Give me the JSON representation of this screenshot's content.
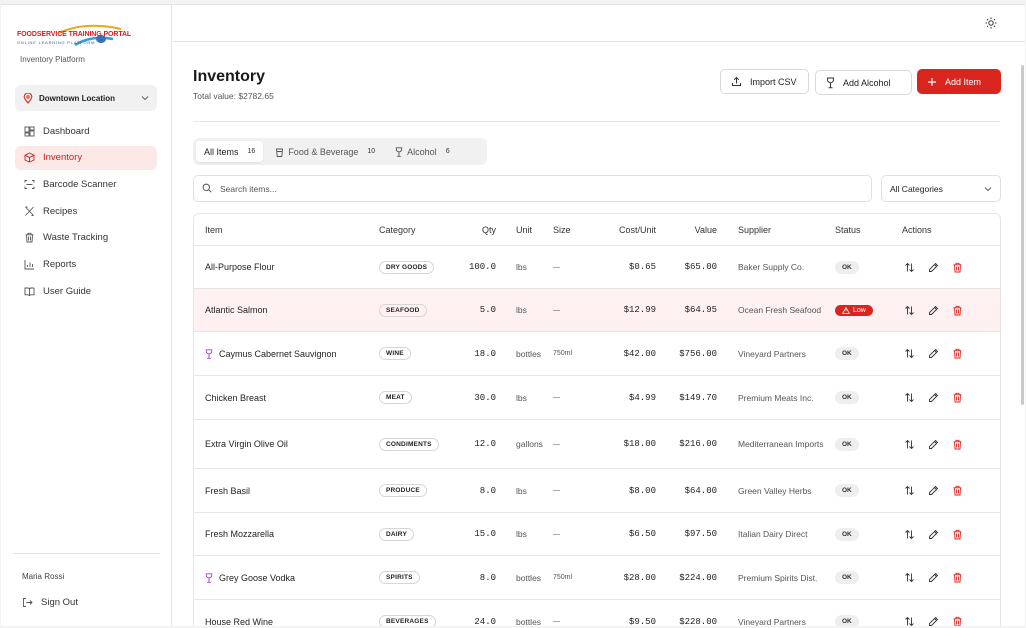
{
  "brand": {
    "logo_text": "FOODSERVICE TRAINING PORTAL",
    "logo_subtext": "ONLINE LEARNING PLATFORM",
    "platform_label": "Inventory Platform"
  },
  "location": {
    "label": "Downtown Location"
  },
  "sidebar": {
    "items": [
      {
        "label": "Dashboard",
        "icon": "dashboard-icon",
        "active": false
      },
      {
        "label": "Inventory",
        "icon": "package-icon",
        "active": true
      },
      {
        "label": "Barcode Scanner",
        "icon": "scan-icon",
        "active": false
      },
      {
        "label": "Recipes",
        "icon": "utensils-icon",
        "active": false
      },
      {
        "label": "Waste Tracking",
        "icon": "trash-icon",
        "active": false
      },
      {
        "label": "Reports",
        "icon": "bar-chart-icon",
        "active": false
      },
      {
        "label": "User Guide",
        "icon": "book-icon",
        "active": false
      }
    ],
    "user_name": "Maria Rossi",
    "signout_label": "Sign Out"
  },
  "header": {
    "title": "Inventory",
    "total_value": "Total value: $2782.65",
    "import_label": "Import CSV",
    "add_alcohol_label": "Add Alcohol",
    "add_item_label": "Add Item"
  },
  "tabs": [
    {
      "label": "All Items",
      "count": "16",
      "active": true
    },
    {
      "label": "Food & Beverage",
      "count": "10",
      "active": false
    },
    {
      "label": "Alcohol",
      "count": "6",
      "active": false
    }
  ],
  "search": {
    "placeholder": "Search items..."
  },
  "category_filter": {
    "selected": "All Categories"
  },
  "table": {
    "headers": {
      "item": "Item",
      "category": "Category",
      "qty": "Qty",
      "unit": "Unit",
      "size": "Size",
      "cost": "Cost/Unit",
      "value": "Value",
      "supplier": "Supplier",
      "status": "Status",
      "actions": "Actions"
    },
    "rows": [
      {
        "item": "All-Purpose Flour",
        "alcohol": false,
        "category": "DRY GOODS",
        "qty": "100.0",
        "unit": "lbs",
        "size": "—",
        "cost": "$0.65",
        "value": "$65.00",
        "supplier": "Baker Supply Co.",
        "status": "OK",
        "low": false
      },
      {
        "item": "Atlantic Salmon",
        "alcohol": false,
        "category": "SEAFOOD",
        "qty": "5.0",
        "unit": "lbs",
        "size": "—",
        "cost": "$12.99",
        "value": "$64.95",
        "supplier": "Ocean Fresh Seafood",
        "status": "Low",
        "low": true
      },
      {
        "item": "Caymus Cabernet Sauvignon",
        "alcohol": true,
        "category": "WINE",
        "qty": "18.0",
        "unit": "bottles",
        "size": "750ml",
        "cost": "$42.00",
        "value": "$756.00",
        "supplier": "Vineyard Partners",
        "status": "OK",
        "low": false
      },
      {
        "item": "Chicken Breast",
        "alcohol": false,
        "category": "MEAT",
        "qty": "30.0",
        "unit": "lbs",
        "size": "—",
        "cost": "$4.99",
        "value": "$149.70",
        "supplier": "Premium Meats Inc.",
        "status": "OK",
        "low": false
      },
      {
        "item": "Extra Virgin Olive Oil",
        "alcohol": false,
        "category": "CONDIMENTS",
        "qty": "12.0",
        "unit": "gallons",
        "size": "—",
        "cost": "$18.00",
        "value": "$216.00",
        "supplier": "Mediterranean Imports",
        "status": "OK",
        "low": false
      },
      {
        "item": "Fresh Basil",
        "alcohol": false,
        "category": "PRODUCE",
        "qty": "8.0",
        "unit": "lbs",
        "size": "—",
        "cost": "$8.00",
        "value": "$64.00",
        "supplier": "Green Valley Herbs",
        "status": "OK",
        "low": false
      },
      {
        "item": "Fresh Mozzarella",
        "alcohol": false,
        "category": "DAIRY",
        "qty": "15.0",
        "unit": "lbs",
        "size": "—",
        "cost": "$6.50",
        "value": "$97.50",
        "supplier": "Italian Dairy Direct",
        "status": "OK",
        "low": false
      },
      {
        "item": "Grey Goose Vodka",
        "alcohol": true,
        "category": "SPIRITS",
        "qty": "8.0",
        "unit": "bottles",
        "size": "750ml",
        "cost": "$28.00",
        "value": "$224.00",
        "supplier": "Premium Spirits Dist.",
        "status": "OK",
        "low": false
      },
      {
        "item": "House Red Wine",
        "alcohol": false,
        "category": "BEVERAGES",
        "qty": "24.0",
        "unit": "bottles",
        "size": "—",
        "cost": "$9.50",
        "value": "$228.00",
        "supplier": "Vineyard Partners",
        "status": "OK",
        "low": false
      }
    ]
  },
  "colors": {
    "accent": "#d9251d",
    "active_bg": "#fde8e8",
    "low_row_bg": "#fff1f1",
    "wine_icon": "#a23ec9"
  }
}
